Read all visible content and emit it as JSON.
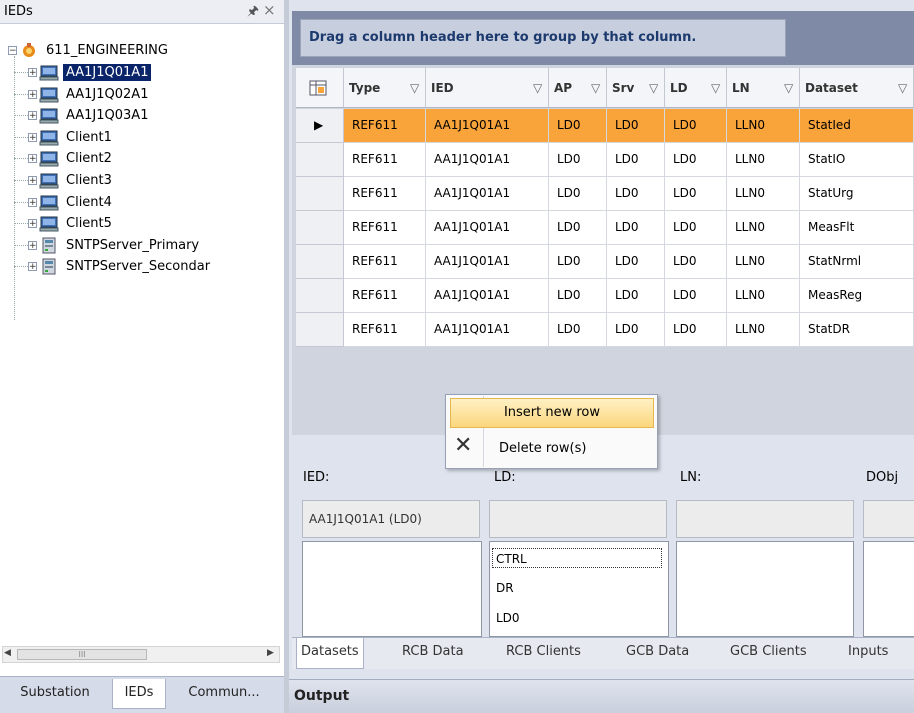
{
  "left_panel": {
    "title": "IEDs",
    "root": "611_ENGINEERING",
    "items": [
      {
        "label": "AA1J1Q01A1",
        "type": "ied",
        "selected": true
      },
      {
        "label": "AA1J1Q02A1",
        "type": "ied"
      },
      {
        "label": "AA1J1Q03A1",
        "type": "ied"
      },
      {
        "label": "Client1",
        "type": "client"
      },
      {
        "label": "Client2",
        "type": "client"
      },
      {
        "label": "Client3",
        "type": "client"
      },
      {
        "label": "Client4",
        "type": "client"
      },
      {
        "label": "Client5",
        "type": "client"
      },
      {
        "label": "SNTPServer_Primary",
        "type": "server"
      },
      {
        "label": "SNTPServer_Secondar",
        "type": "server"
      }
    ],
    "tabs": [
      "Substation",
      "IEDs",
      "Commun..."
    ],
    "scroll_grip": "III"
  },
  "grid": {
    "group_hint": "Drag a column header here to group by that column.",
    "columns": [
      "Type",
      "IED",
      "AP",
      "Srv",
      "LD",
      "LN",
      "Dataset"
    ],
    "rows": [
      [
        "REF611",
        "AA1J1Q01A1",
        "LD0",
        "LD0",
        "LD0",
        "LLN0",
        "StatIed"
      ],
      [
        "REF611",
        "AA1J1Q01A1",
        "LD0",
        "LD0",
        "LD0",
        "LLN0",
        "StatIO"
      ],
      [
        "REF611",
        "AA1J1Q01A1",
        "LD0",
        "LD0",
        "LD0",
        "LLN0",
        "StatUrg"
      ],
      [
        "REF611",
        "AA1J1Q01A1",
        "LD0",
        "LD0",
        "LD0",
        "LLN0",
        "MeasFlt"
      ],
      [
        "REF611",
        "AA1J1Q01A1",
        "LD0",
        "LD0",
        "LD0",
        "LLN0",
        "StatNrml"
      ],
      [
        "REF611",
        "AA1J1Q01A1",
        "LD0",
        "LD0",
        "LD0",
        "LLN0",
        "MeasReg"
      ],
      [
        "REF611",
        "AA1J1Q01A1",
        "LD0",
        "LD0",
        "LD0",
        "LLN0",
        "StatDR"
      ]
    ],
    "selected_row": 0,
    "row_arrow": "▶"
  },
  "context_menu": {
    "insert": "Insert new row",
    "delete": "Delete row(s)"
  },
  "editor": {
    "labels": {
      "ied": "IED:",
      "ld": "LD:",
      "ln": "LN:",
      "dobj": "DObj"
    },
    "ied_value": "AA1J1Q01A1 (LD0)",
    "ld_list": [
      "CTRL",
      "DR",
      "LD0"
    ]
  },
  "bottom_tabs": [
    "Datasets",
    "RCB Data",
    "RCB Clients",
    "GCB Data",
    "GCB Clients",
    "Inputs"
  ],
  "output_title": "Output",
  "colors": {
    "selection_orange": "#f9a33b",
    "tree_selection": "#0a246a",
    "group_header_text": "#1d3a6e"
  }
}
